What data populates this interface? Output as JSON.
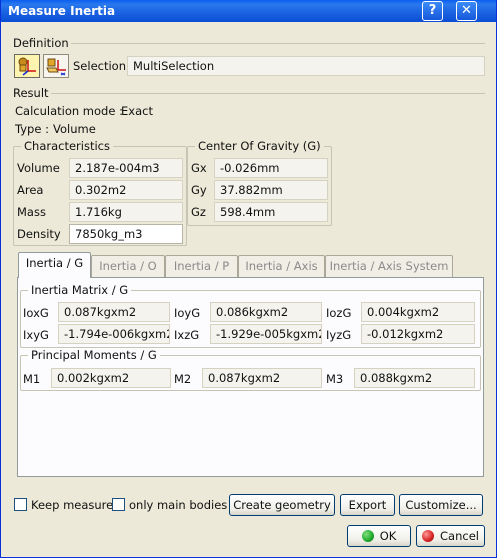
{
  "window": {
    "title": "Measure Inertia",
    "help_glyph": "?",
    "close_glyph": "✕"
  },
  "definition": {
    "header": "Definition",
    "icons": [
      "measure-inertia-3d-icon",
      "measure-inertia-2d-icon"
    ],
    "selection_label": "Selection :",
    "selection_value": "MultiSelection"
  },
  "result": {
    "header": "Result",
    "calc_mode_label": "Calculation mode :",
    "calc_mode_value": "Exact",
    "type_label": "Type :",
    "type_value": "Volume"
  },
  "characteristics": {
    "title": "Characteristics",
    "rows": [
      {
        "label": "Volume",
        "value": "2.187e-004m3"
      },
      {
        "label": "Area",
        "value": "0.302m2"
      },
      {
        "label": "Mass",
        "value": "1.716kg"
      },
      {
        "label": "Density",
        "value": "7850kg_m3"
      }
    ]
  },
  "cog": {
    "title": "Center Of Gravity (G)",
    "rows": [
      {
        "label": "Gx",
        "value": "-0.026mm"
      },
      {
        "label": "Gy",
        "value": "37.882mm"
      },
      {
        "label": "Gz",
        "value": "598.4mm"
      }
    ]
  },
  "tabs": [
    {
      "label": "Inertia / G",
      "active": true
    },
    {
      "label": "Inertia / O",
      "active": false
    },
    {
      "label": "Inertia / P",
      "active": false
    },
    {
      "label": "Inertia / Axis",
      "active": false
    },
    {
      "label": "Inertia / Axis System",
      "active": false
    }
  ],
  "inertia_matrix": {
    "title": "Inertia Matrix / G",
    "rows": [
      [
        {
          "label": "IoxG",
          "value": "0.087kgxm2"
        },
        {
          "label": "IoyG",
          "value": "0.086kgxm2"
        },
        {
          "label": "IozG",
          "value": "0.004kgxm2"
        }
      ],
      [
        {
          "label": "IxyG",
          "value": "-1.794e-006kgxm2"
        },
        {
          "label": "IxzG",
          "value": "-1.929e-005kgxm2"
        },
        {
          "label": "IyzG",
          "value": "-0.012kgxm2"
        }
      ]
    ]
  },
  "principal_moments": {
    "title": "Principal Moments / G",
    "items": [
      {
        "label": "M1",
        "value": "0.002kgxm2"
      },
      {
        "label": "M2",
        "value": "0.087kgxm2"
      },
      {
        "label": "M3",
        "value": "0.088kgxm2"
      }
    ]
  },
  "options": {
    "keep_measure": "Keep measure",
    "only_main_bodies": "only main bodies",
    "keep_measure_checked": false,
    "only_main_bodies_checked": false
  },
  "buttons": {
    "create_geometry": "Create geometry",
    "export": "Export",
    "customize": "Customize...",
    "ok": "OK",
    "cancel": "Cancel"
  },
  "colors": {
    "ok_dot": "#1fa82a",
    "cancel_dot": "#d62020",
    "titlebar": "#0a5ff0"
  }
}
